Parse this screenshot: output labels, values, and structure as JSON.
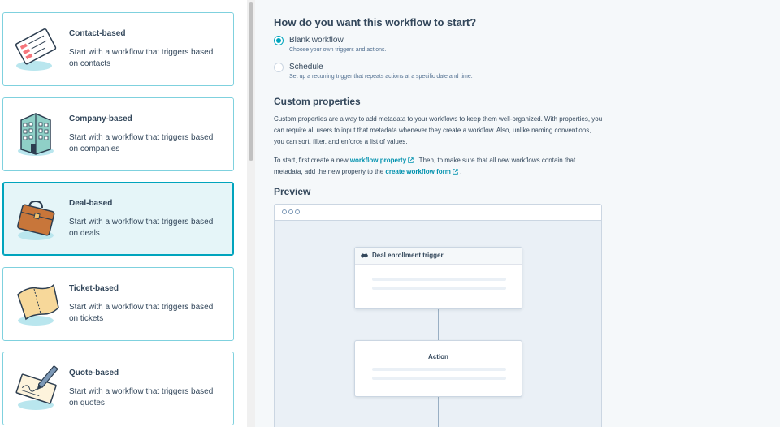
{
  "cards": [
    {
      "id": "contact",
      "title": "Contact-based",
      "description": "Start with a workflow that triggers based on contacts",
      "icon": "contact-card-icon",
      "selected": false
    },
    {
      "id": "company",
      "title": "Company-based",
      "description": "Start with a workflow that triggers based on companies",
      "icon": "building-icon",
      "selected": false
    },
    {
      "id": "deal",
      "title": "Deal-based",
      "description": "Start with a workflow that triggers based on deals",
      "icon": "briefcase-icon",
      "selected": true
    },
    {
      "id": "ticket",
      "title": "Ticket-based",
      "description": "Start with a workflow that triggers based on tickets",
      "icon": "ticket-icon",
      "selected": false
    },
    {
      "id": "quote",
      "title": "Quote-based",
      "description": "Start with a workflow that triggers based on quotes",
      "icon": "signed-document-icon",
      "selected": false
    }
  ],
  "start": {
    "heading": "How do you want this workflow to start?",
    "options": [
      {
        "label": "Blank workflow",
        "description": "Choose your own triggers and actions.",
        "checked": true
      },
      {
        "label": "Schedule",
        "description": "Set up a recurring trigger that repeats actions at a specific date and time.",
        "checked": false
      }
    ]
  },
  "custom_properties": {
    "heading": "Custom properties",
    "paragraph1": "Custom properties are a way to add metadata to your workflows to keep them well-organized. With properties, you can require all users to input that metadata whenever they create a workflow. Also, unlike naming conventions, you can sort, filter, and enforce a list of values.",
    "p2_before": "To start, first create a new ",
    "p2_link1": "workflow property",
    "p2_middle": " . Then, to make sure that all new workflows contain that metadata, add the new property to the ",
    "p2_link2": "create workflow form",
    "p2_after": " ."
  },
  "preview": {
    "heading": "Preview",
    "trigger_label": "Deal enrollment trigger",
    "action_label": "Action"
  },
  "colors": {
    "accent": "#00a4bd",
    "link": "#0091ae",
    "text": "#33475b"
  }
}
